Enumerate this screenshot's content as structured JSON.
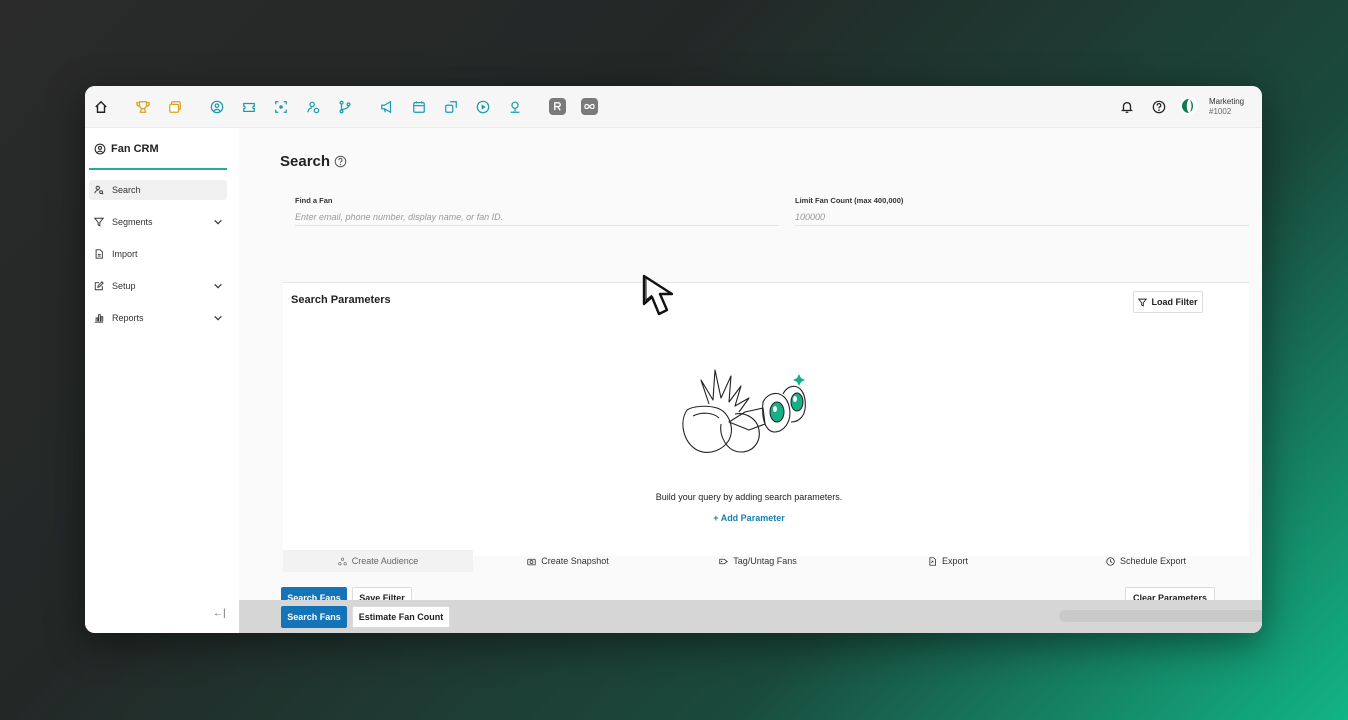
{
  "topbar": {
    "icons": [
      "home-icon",
      "trophy-icon",
      "layers-icon",
      "person-circle-icon",
      "ticket-icon",
      "scan-icon",
      "person-star-icon",
      "branch-icon",
      "megaphone-icon",
      "calendar-icon",
      "share-icon",
      "play-circle-icon",
      "map-pin-icon",
      "app-r-icon",
      "app-infinity-icon",
      "bell-icon",
      "help-icon"
    ],
    "account": {
      "name": "Marketing",
      "id": "#1002"
    }
  },
  "sidebar": {
    "title": "Fan CRM",
    "items": [
      {
        "label": "Search",
        "icon": "person-search-icon",
        "active": true,
        "has_submenu": false
      },
      {
        "label": "Segments",
        "icon": "funnel-icon",
        "active": false,
        "has_submenu": true
      },
      {
        "label": "Import",
        "icon": "file-icon",
        "active": false,
        "has_submenu": false
      },
      {
        "label": "Setup",
        "icon": "edit-icon",
        "active": false,
        "has_submenu": true
      },
      {
        "label": "Reports",
        "icon": "chart-icon",
        "active": false,
        "has_submenu": true
      }
    ],
    "collapse_label": "←|"
  },
  "main": {
    "title": "Search",
    "find_fan": {
      "label": "Find a Fan",
      "placeholder": "Enter email, phone number, display name, or fan ID."
    },
    "limit": {
      "label": "Limit Fan Count (max 400,000)",
      "placeholder": "100000"
    },
    "params_title": "Search Parameters",
    "load_filter": "Load Filter",
    "empty_text": "Build your query by adding search parameters.",
    "add_parameter": "+ Add Parameter",
    "actions": [
      "Create Audience",
      "Create Snapshot",
      "Tag/Untag Fans",
      "Export",
      "Schedule Export"
    ],
    "search_fans": "Search Fans",
    "save_filter": "Save Filter",
    "clear_parameters": "Clear Parameters"
  },
  "footer": {
    "search_fans": "Search Fans",
    "estimate": "Estimate Fan Count"
  },
  "colors": {
    "primary": "#1574b8",
    "accent": "#27a8a0",
    "icon_teal": "#1a9bb0",
    "trophy": "#d9a21b"
  }
}
